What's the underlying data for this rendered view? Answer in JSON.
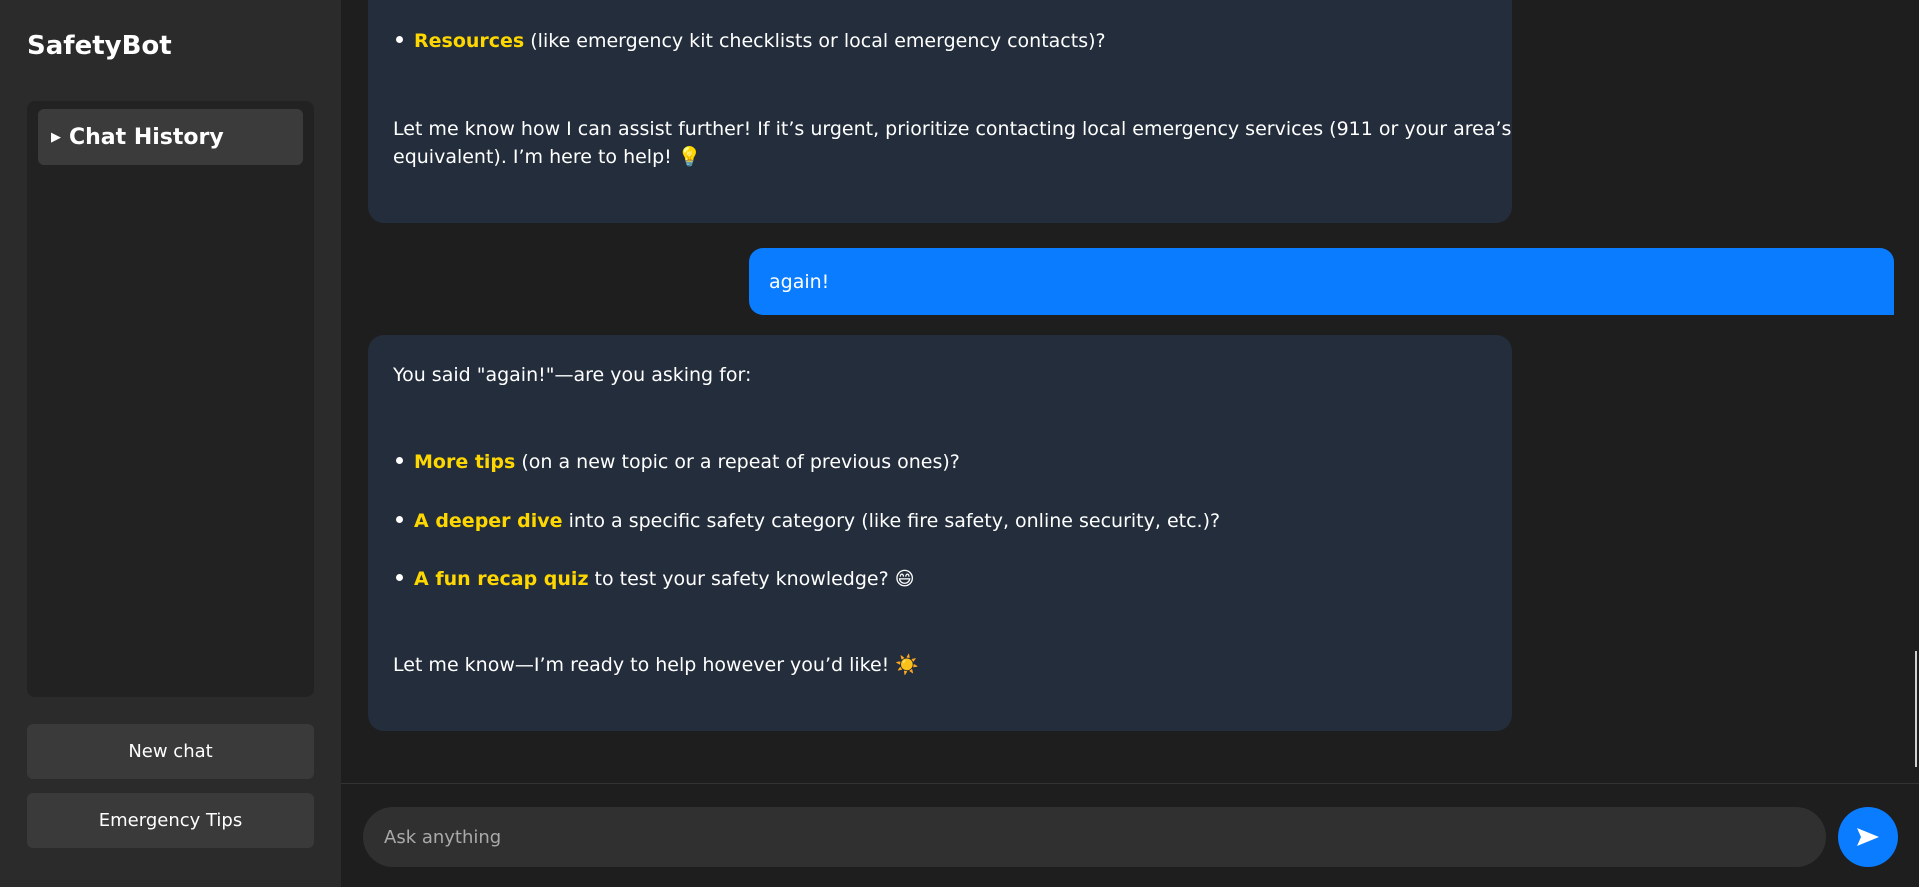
{
  "app": {
    "title": "SafetyBot"
  },
  "sidebar": {
    "history_label": "Chat History",
    "buttons": {
      "new_chat": "New chat",
      "emergency_tips": "Emergency Tips"
    }
  },
  "messages": [
    {
      "role": "bot",
      "bullets": [
        {
          "highlight": "Resources",
          "text": " (like emergency kit checklists or local emergency contacts)?"
        }
      ],
      "closing_line1": "Let me know how I can assist further! If it’s urgent, prioritize contacting local emergency services (911 or your area’s",
      "closing_line2": "equivalent). I’m here to help!",
      "closing_emoji": "💡"
    },
    {
      "role": "user",
      "text": "again!"
    },
    {
      "role": "bot",
      "intro": "You said \"again!\"—are you asking for:",
      "bullets": [
        {
          "highlight": "More tips",
          "text": " (on a new topic or a repeat of previous ones)?"
        },
        {
          "highlight": "A deeper dive",
          "text": " into a specific safety category (like fire safety, online security, etc.)?"
        },
        {
          "highlight": "A fun recap quiz",
          "text": " to test your safety knowledge? 😄"
        }
      ],
      "closing": "Let me know—I’m ready to help however you’d like! ☀️"
    }
  ],
  "input": {
    "placeholder": "Ask anything",
    "value": ""
  },
  "icons": {
    "send": "send-arrow-icon",
    "toggle": "triangle-right-icon"
  },
  "colors": {
    "accent": "#0a7cff",
    "highlight": "#ffd700",
    "bot_bubble": "#232d3b"
  }
}
